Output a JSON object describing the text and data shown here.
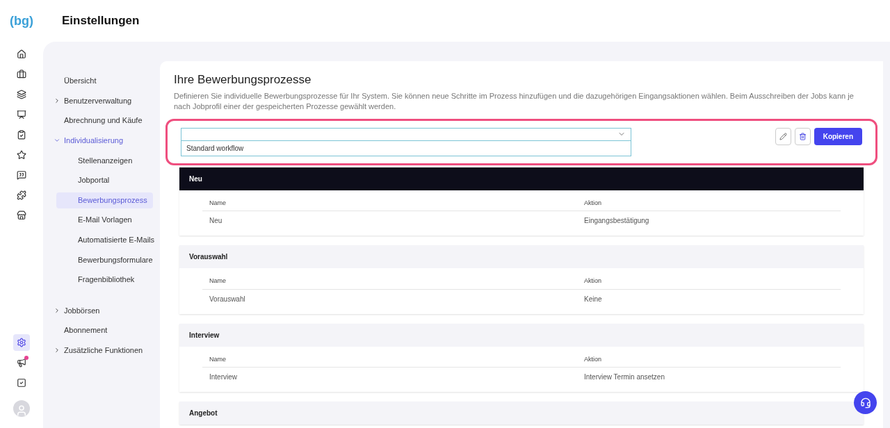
{
  "header": {
    "logo": "(bg)",
    "title": "Einstellungen"
  },
  "rail": [
    {
      "kind": "home",
      "selected": false
    },
    {
      "kind": "briefcase",
      "selected": false
    },
    {
      "kind": "layers",
      "selected": false
    },
    {
      "kind": "presentation",
      "selected": false
    },
    {
      "kind": "clipboard",
      "selected": false
    },
    {
      "kind": "star",
      "selected": false
    },
    {
      "kind": "message",
      "selected": false
    },
    {
      "kind": "puzzle",
      "selected": false
    },
    {
      "kind": "store",
      "selected": false
    }
  ],
  "rail_bottom": [
    {
      "kind": "settings",
      "selected": true
    },
    {
      "kind": "megaphone",
      "selected": false,
      "badge": true
    },
    {
      "kind": "check",
      "selected": false
    }
  ],
  "sidebar": {
    "groups": [
      [
        {
          "label": "Übersicht",
          "selected": false
        },
        {
          "label": "Benutzerverwaltung",
          "selected": false,
          "expanded": false
        },
        {
          "label": "Abrechnung und Käufe",
          "selected": false
        },
        {
          "label": "Individualisierung",
          "selected": false,
          "expanded": true,
          "children": [
            {
              "label": "Stellenanzeigen",
              "selected": false
            },
            {
              "label": "Jobportal",
              "selected": false
            },
            {
              "label": "Bewerbungsprozess",
              "selected": true
            },
            {
              "label": "E-Mail Vorlagen",
              "selected": false
            },
            {
              "label": "Automatisierte E-Mails",
              "selected": false
            },
            {
              "label": "Bewerbungsformulare",
              "selected": false
            },
            {
              "label": "Fragenbibliothek",
              "selected": false
            }
          ]
        }
      ],
      [
        {
          "label": "Jobbörsen",
          "selected": false,
          "expanded": false
        },
        {
          "label": "Abonnement",
          "selected": false
        },
        {
          "label": "Zusätzliche Funktionen",
          "selected": false,
          "expanded": false
        }
      ]
    ]
  },
  "content": {
    "title": "Ihre Bewerbungsprozesse",
    "description": "Definieren Sie individuelle Bewerbungsprozesse für Ihr System. Sie können neue Schritte im Prozess hinzufügen und die dazugehörigen Eingangsaktionen wählen. Beim Ausschreiben der Jobs kann je nach Jobprofil einer der gespeicherten Prozesse gewählt werden.",
    "select": {
      "options": [
        "Standard workflow"
      ]
    },
    "copy_button": "Kopieren",
    "stages": [
      {
        "title": "Neu",
        "selected": true,
        "columns": [
          "Name",
          "Aktion"
        ],
        "row": [
          "Neu",
          "Eingangsbestätigung"
        ]
      },
      {
        "title": "Vorauswahl",
        "selected": false,
        "columns": [
          "Name",
          "Aktion"
        ],
        "row": [
          "Vorauswahl",
          "Keine"
        ]
      },
      {
        "title": "Interview",
        "selected": false,
        "columns": [
          "Name",
          "Aktion"
        ],
        "row": [
          "Interview",
          "Interview Termin ansetzen"
        ]
      },
      {
        "title": "Angebot",
        "selected": false
      }
    ]
  }
}
